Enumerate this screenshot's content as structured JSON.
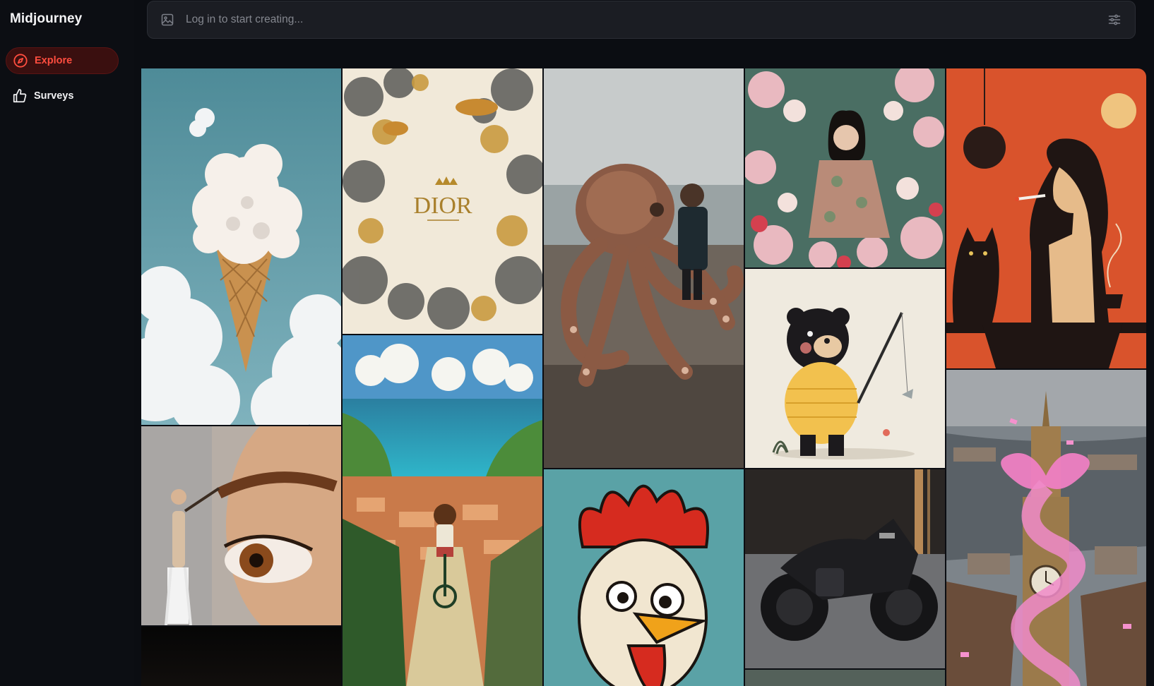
{
  "app": {
    "brand": "Midjourney"
  },
  "sidebar": {
    "items": [
      {
        "label": "Explore",
        "icon": "compass-icon",
        "active": true
      },
      {
        "label": "Surveys",
        "icon": "thumbs-up-icon",
        "active": false
      }
    ]
  },
  "prompt": {
    "placeholder": "Log in to start creating...",
    "value": ""
  },
  "gallery": {
    "tiles": [
      {
        "id": "ice-cream-cloud",
        "col": 0
      },
      {
        "id": "eye-painter",
        "col": 0
      },
      {
        "id": "dark-tile",
        "col": 0
      },
      {
        "id": "dior-toile",
        "col": 1,
        "text": "DIOR"
      },
      {
        "id": "coastal-cyclist",
        "col": 1
      },
      {
        "id": "octopus-beach",
        "col": 2
      },
      {
        "id": "rooster-poster",
        "col": 2
      },
      {
        "id": "floral-portrait",
        "col": 3
      },
      {
        "id": "bear-fishing",
        "col": 3
      },
      {
        "id": "black-motorcycle",
        "col": 3
      },
      {
        "id": "grey-tile",
        "col": 3
      },
      {
        "id": "woman-cat-poster",
        "col": 4
      },
      {
        "id": "big-ben-ribbon",
        "col": 4
      }
    ]
  },
  "colors": {
    "accent": "#ff4d3f",
    "accent_bg": "#3a0f0f",
    "background": "#0b0d12",
    "bar": "#1b1d23"
  }
}
